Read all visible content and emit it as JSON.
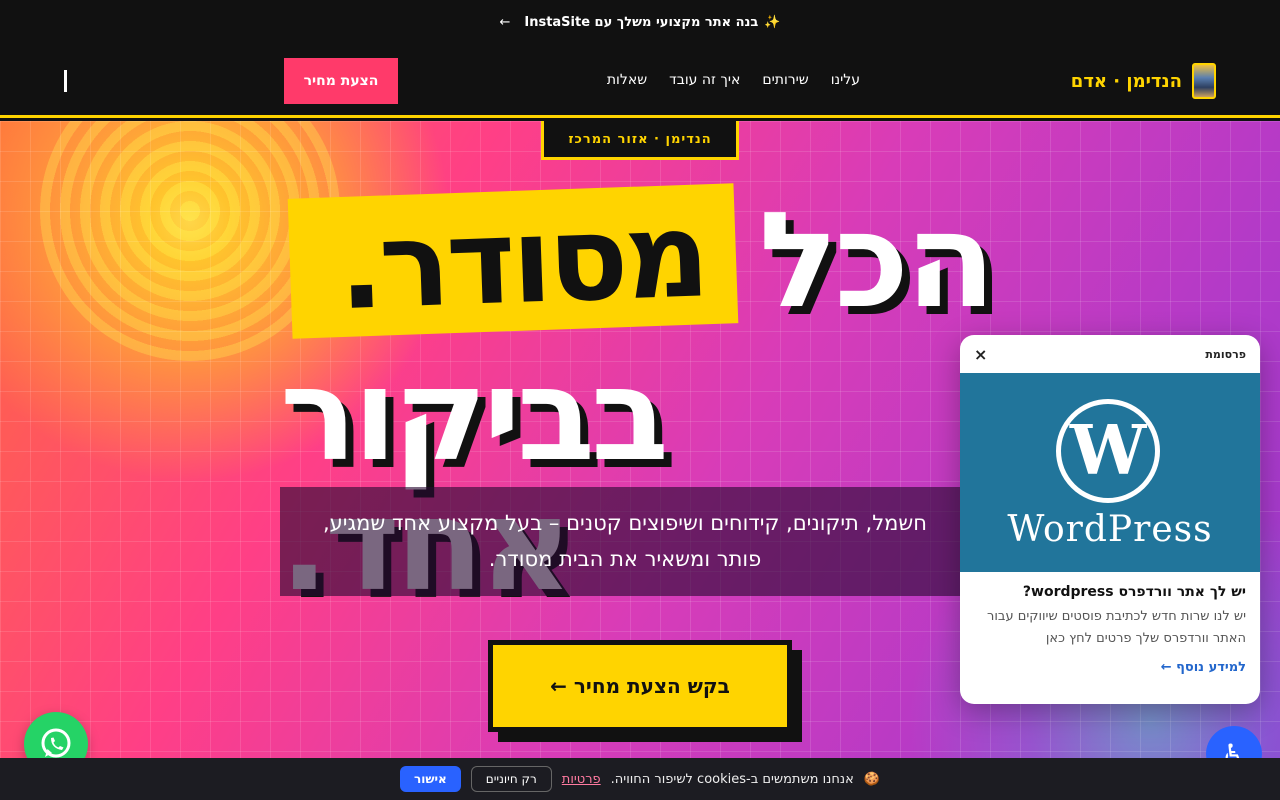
{
  "announcement": {
    "icon": "sparkles-icon",
    "text": "בנה אתר מקצועי משלך עם InstaSite",
    "arrow": "←"
  },
  "nav": {
    "brand": "הנדימן · אדם",
    "links": [
      "עלינו",
      "שירותים",
      "איך זה עובד",
      "שאלות"
    ],
    "cta": "הצעת מחיר"
  },
  "hero": {
    "tag": "הנדימן · אזור המרכז",
    "headline_word1": "הכל",
    "headline_highlight": "מסודר.",
    "headline_line2": "בביקור אחד.",
    "subtext": "חשמל, תיקונים, קידוחים ושיפוצים קטנים – בעל מקצוע אחד שמגיע, פותר ומשאיר את הבית מסודר.",
    "cta": "בקש הצעת מחיר ←"
  },
  "ad": {
    "label": "פרסומת",
    "close": "×",
    "logo_letter": "W",
    "logo_word": "WordPress",
    "title": "יש לך אתר וורדפרס wordpress?",
    "body": "יש לנו שרות חדש לכתיבת פוסטים שיווקים עבור האתר וורדפרס שלך פרטים לחץ כאן",
    "link": "למידע נוסף ←"
  },
  "cookie": {
    "icon": "cookie-icon",
    "text": "אנחנו משתמשים ב-cookies לשיפור החוויה.",
    "link": "פרטיות",
    "essential": "רק חיוניים",
    "accept": "אישור"
  },
  "colors": {
    "accent": "#ffd400",
    "brand_pink": "#ff3a6a",
    "whatsapp": "#25d366",
    "a11y": "#2962ff"
  }
}
